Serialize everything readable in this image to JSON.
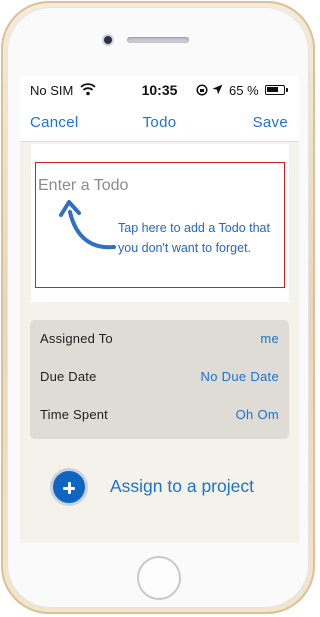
{
  "status_bar": {
    "carrier": "No SIM",
    "time": "10:35",
    "battery_percent": "65 %",
    "icons": [
      "wifi-icon",
      "rotation-lock-icon",
      "location-arrow-icon",
      "battery-icon"
    ]
  },
  "nav": {
    "cancel_label": "Cancel",
    "title": "Todo",
    "save_label": "Save"
  },
  "todo_input": {
    "placeholder": "Enter a Todo",
    "value": "",
    "hint": "Tap here to add a Todo that you don't want to forget.",
    "hint_icon": "curved-arrow-icon"
  },
  "details": [
    {
      "label": "Assigned To",
      "value": "me"
    },
    {
      "label": "Due Date",
      "value": "No Due Date"
    },
    {
      "label": "Time Spent",
      "value": "Oh Om"
    }
  ],
  "assign": {
    "label": "Assign to a project",
    "icon": "plus-circle-icon"
  },
  "colors": {
    "accent": "#1a74d1",
    "input_border": "#cc2222",
    "screen_bg": "#f4f2ea",
    "details_bg": "#dedcd4",
    "frame_gold": "#e9d6b8"
  }
}
